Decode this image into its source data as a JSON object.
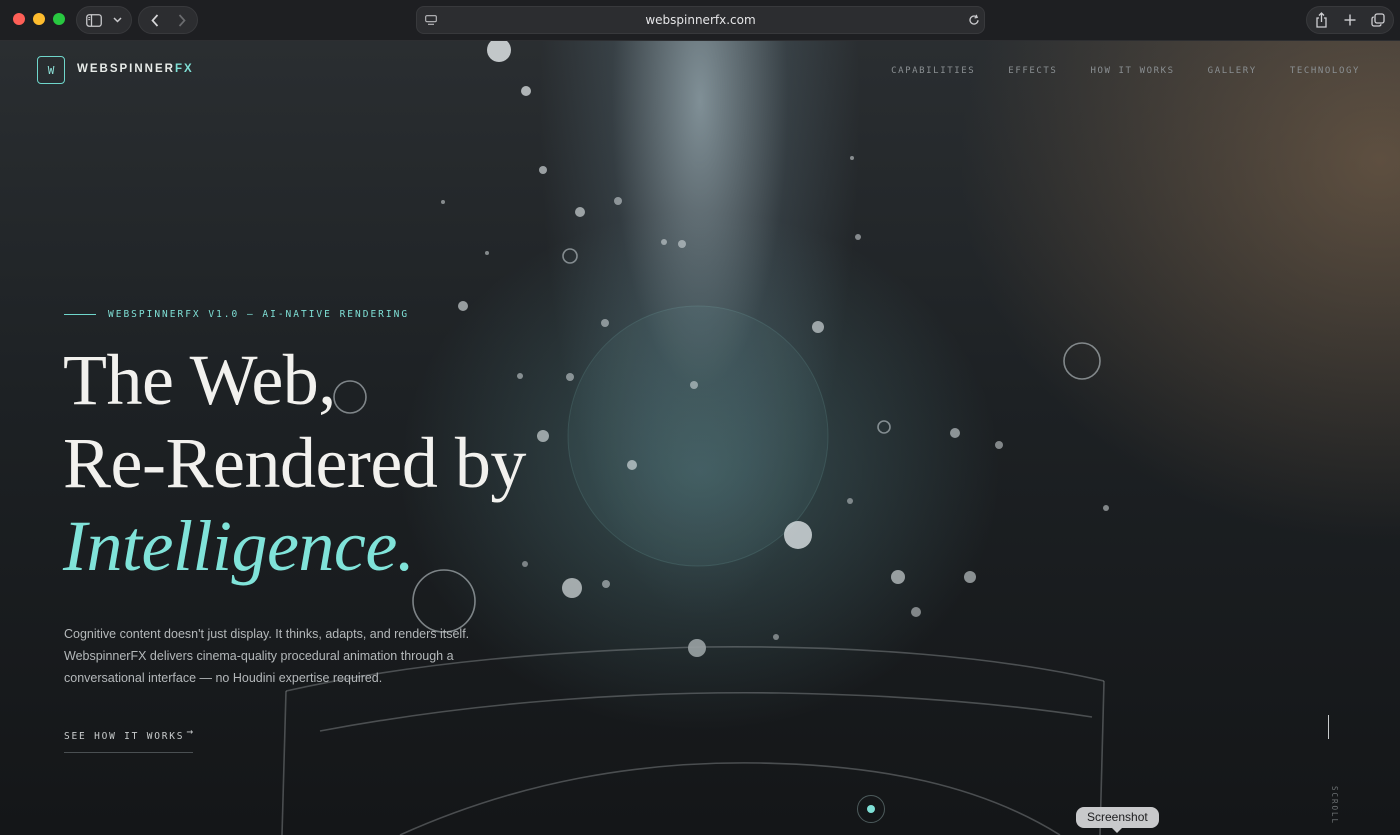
{
  "browser": {
    "url": "webspinnerfx.com",
    "traffic_colors": [
      "#fe5f57",
      "#febc2e",
      "#28c840"
    ]
  },
  "header": {
    "logo_letter": "W",
    "brand_main": "WEBSPINNER",
    "brand_accent": "FX",
    "nav": [
      "CAPABILITIES",
      "EFFECTS",
      "HOW IT WORKS",
      "GALLERY",
      "TECHNOLOGY"
    ]
  },
  "hero": {
    "eyebrow": "WEBSPINNERFX V1.0 — AI-NATIVE RENDERING",
    "headline_line1": "The Web,",
    "headline_line2": "Re-Rendered by",
    "headline_line3": "Intelligence.",
    "description": "Cognitive content doesn't just display. It thinks, adapts, and renders itself. WebspinnerFX delivers cinema-quality procedural animation through a conversational interface — no Houdini expertise required.",
    "cta_label": "SEE HOW IT WORKS",
    "cta_arrow": "→",
    "scroll_label": "SCROLL"
  },
  "tooltip": {
    "text": "Screenshot"
  },
  "theme": {
    "accent": "#7fe0d6",
    "background": "#1b1c1f"
  }
}
